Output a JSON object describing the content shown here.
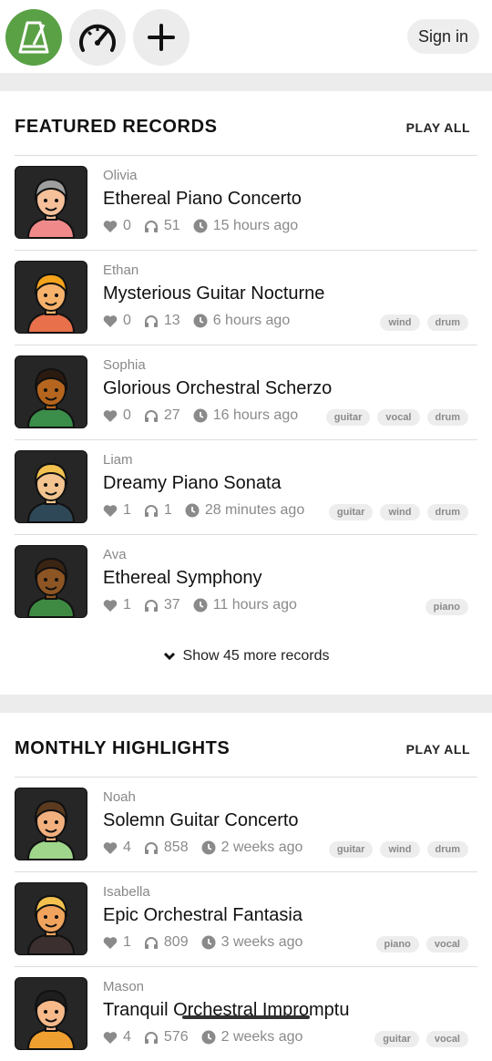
{
  "topbar": {
    "icons": [
      "metronome-icon",
      "speedometer-icon",
      "plus-icon"
    ],
    "sign_in": "Sign in",
    "accent": "#5aa146"
  },
  "featured": {
    "title": "FEATURED RECORDS",
    "play_all": "PLAY ALL",
    "items": [
      {
        "author": "Olivia",
        "title": "Ethereal Piano Concerto",
        "likes": "0",
        "listens": "51",
        "time": "15 hours ago",
        "tags": []
      },
      {
        "author": "Ethan",
        "title": "Mysterious Guitar Nocturne",
        "likes": "0",
        "listens": "13",
        "time": "6 hours ago",
        "tags": [
          "wind",
          "drum"
        ]
      },
      {
        "author": "Sophia",
        "title": "Glorious Orchestral Scherzo",
        "likes": "0",
        "listens": "27",
        "time": "16 hours ago",
        "tags": [
          "guitar",
          "vocal",
          "drum"
        ]
      },
      {
        "author": "Liam",
        "title": "Dreamy Piano Sonata",
        "likes": "1",
        "listens": "1",
        "time": "28 minutes ago",
        "tags": [
          "guitar",
          "wind",
          "drum"
        ]
      },
      {
        "author": "Ava",
        "title": "Ethereal Symphony",
        "likes": "1",
        "listens": "37",
        "time": "11 hours ago",
        "tags": [
          "piano"
        ]
      }
    ],
    "show_more": "Show 45 more records"
  },
  "monthly": {
    "title": "MONTHLY HIGHLIGHTS",
    "play_all": "PLAY ALL",
    "items": [
      {
        "author": "Noah",
        "title": "Solemn Guitar Concerto",
        "likes": "4",
        "listens": "858",
        "time": "2 weeks ago",
        "tags": [
          "guitar",
          "wind",
          "drum"
        ]
      },
      {
        "author": "Isabella",
        "title": "Epic Orchestral Fantasia",
        "likes": "1",
        "listens": "809",
        "time": "3 weeks ago",
        "tags": [
          "piano",
          "vocal"
        ]
      },
      {
        "author": "Mason",
        "title": "Tranquil Orchestral Impromptu",
        "likes": "4",
        "listens": "576",
        "time": "2 weeks ago",
        "tags": [
          "guitar",
          "vocal"
        ]
      }
    ]
  }
}
